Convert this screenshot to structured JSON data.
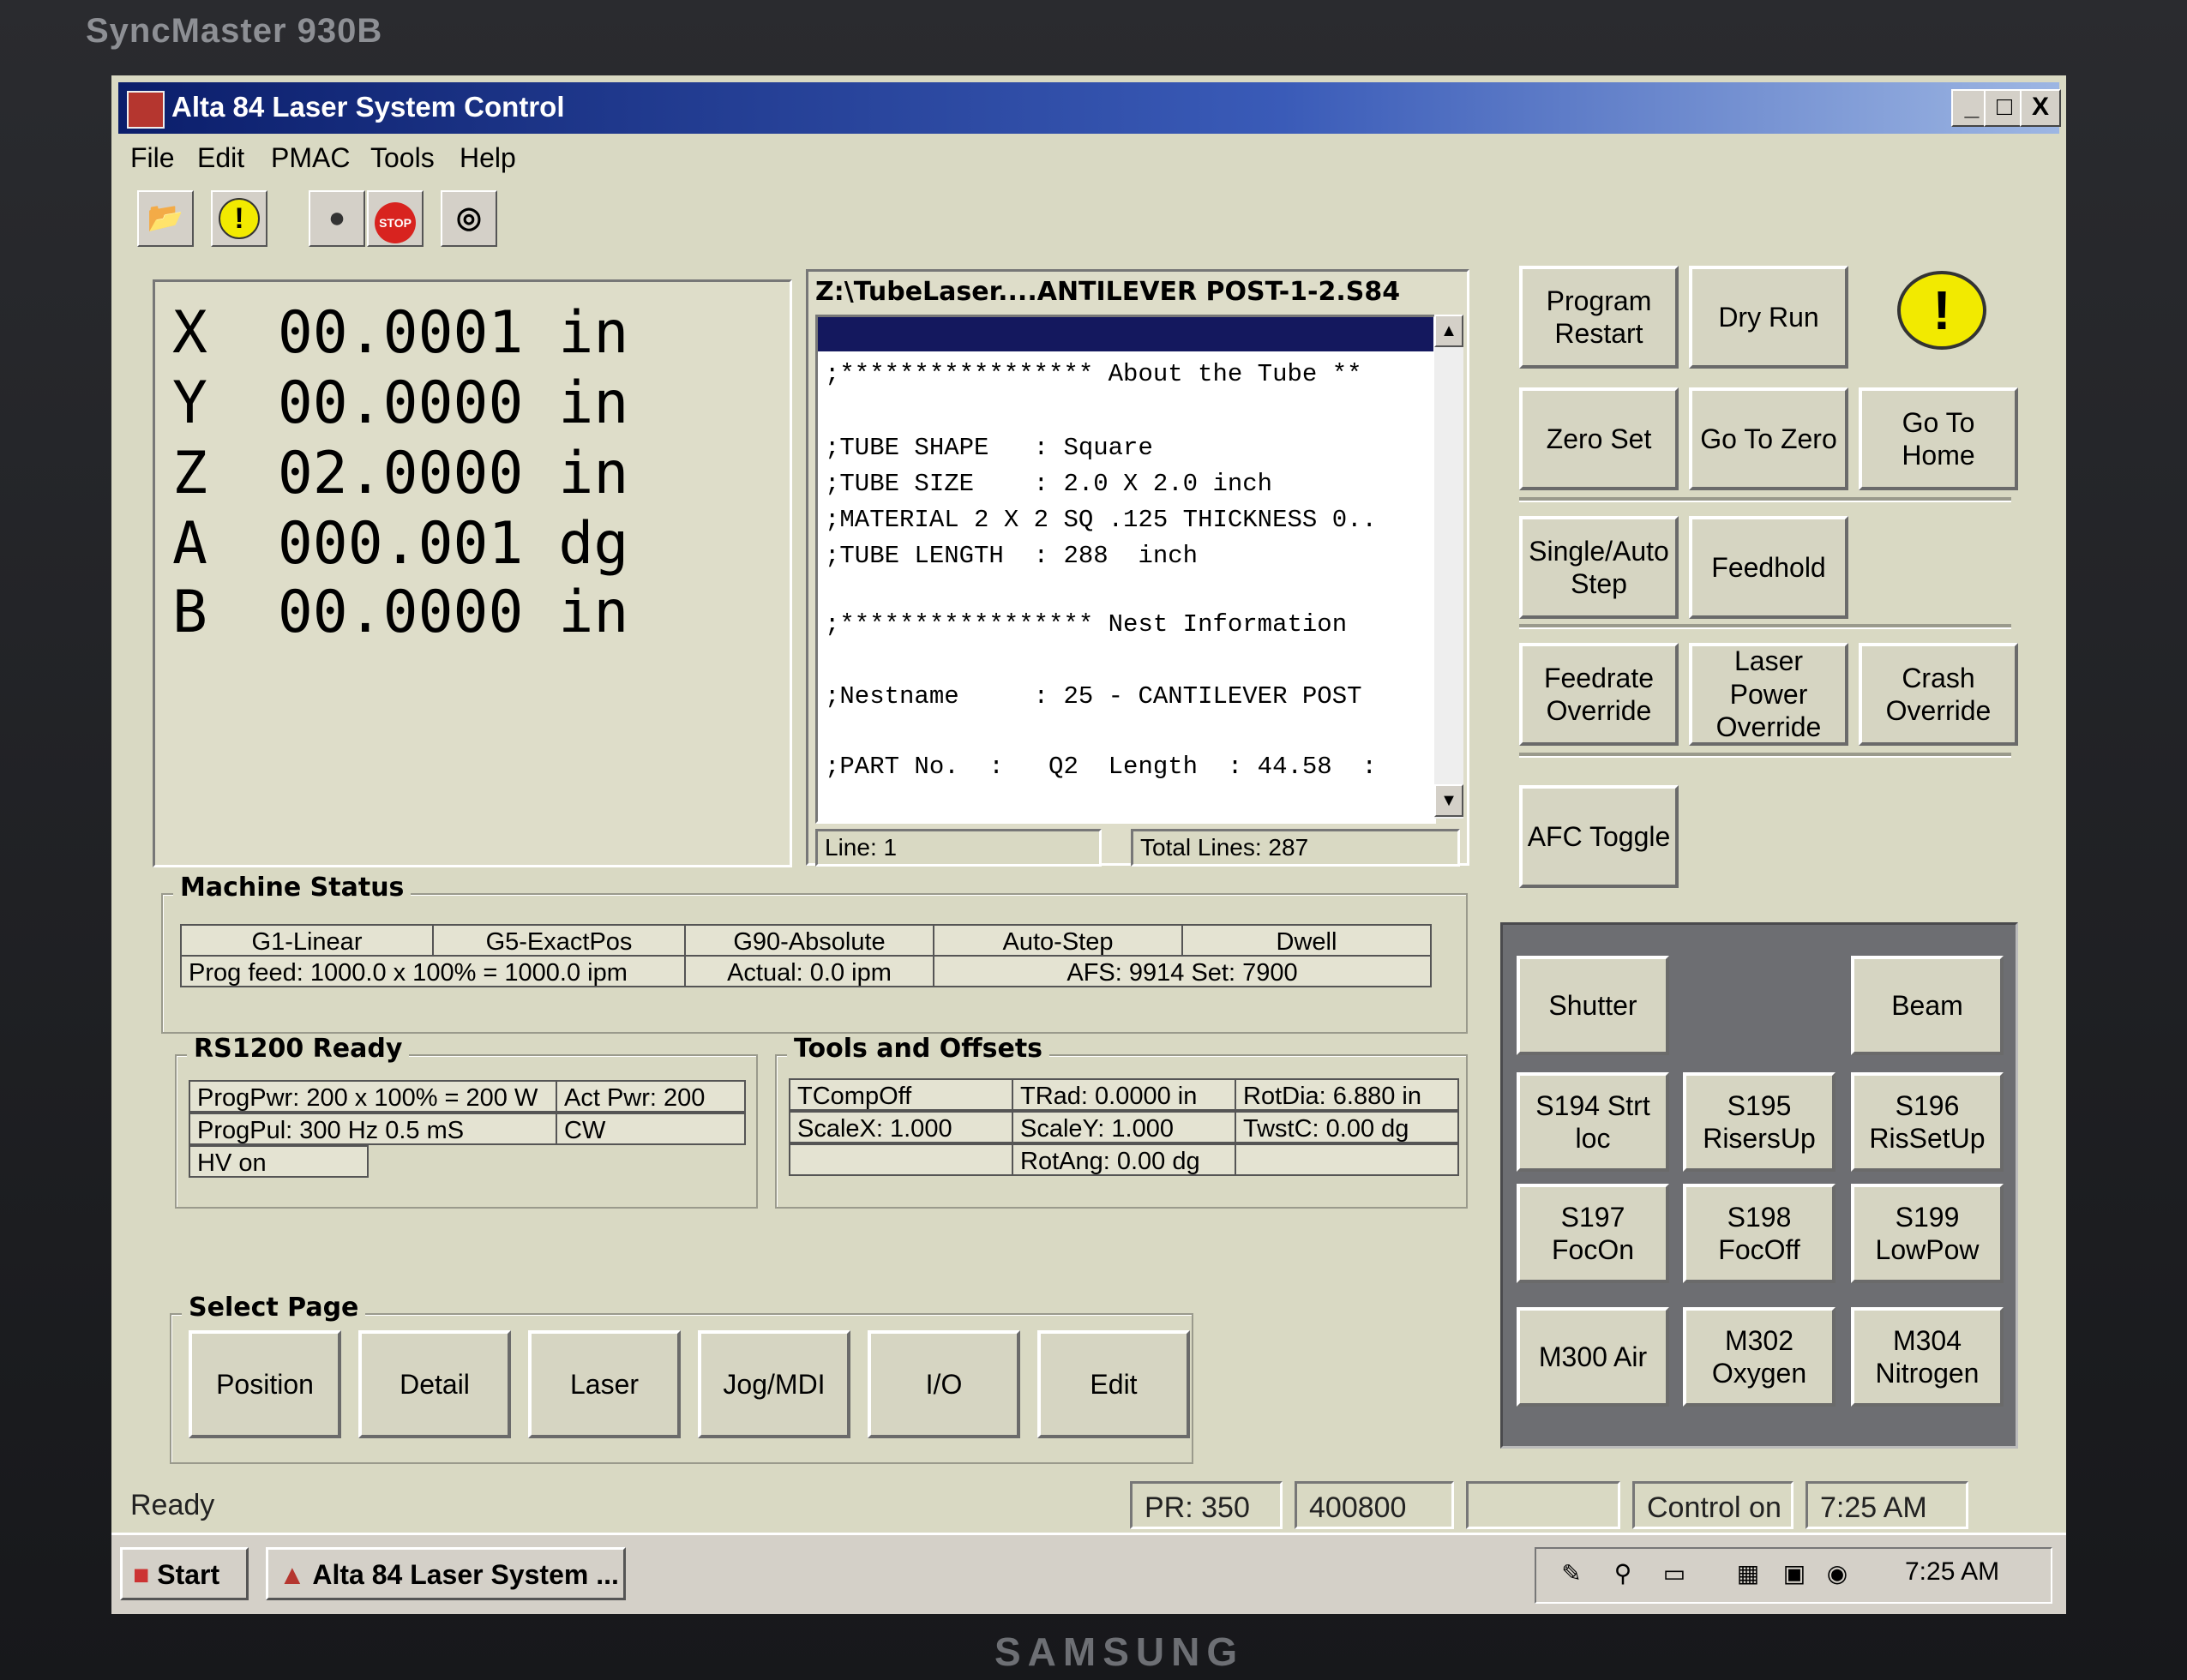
{
  "monitor": {
    "model": "SyncMaster 930B",
    "brand": "SAMSUNG"
  },
  "window": {
    "title": "Alta 84 Laser System Control",
    "min_label": "_",
    "max_label": "□",
    "close_label": "X"
  },
  "menu": [
    "File",
    "Edit",
    "PMAC",
    "Tools",
    "Help"
  ],
  "toolbar": {
    "open_icon": "📂",
    "alert_icon": "!",
    "traffic_icon": "●",
    "stop_label": "STOP",
    "power_icon": "◎"
  },
  "positions": [
    {
      "axis": "X",
      "value": "00.0001",
      "unit": "in"
    },
    {
      "axis": "Y",
      "value": "00.0000",
      "unit": "in"
    },
    {
      "axis": "Z",
      "value": "02.0000",
      "unit": "in"
    },
    {
      "axis": "A",
      "value": "000.001",
      "unit": "dg"
    },
    {
      "axis": "B",
      "value": "00.0000",
      "unit": "in"
    }
  ],
  "file": {
    "title": "Z:\\TubeLaser....ANTILEVER POST-1-2.S84",
    "lines": [
      ";***************** About the Tube **",
      ";TUBE SHAPE   : Square",
      ";TUBE SIZE    : 2.0 X 2.0 inch",
      ";MATERIAL 2 X 2 SQ .125 THICKNESS 0..",
      ";TUBE LENGTH  : 288  inch",
      ";***************** Nest Information",
      ";Nestname     : 25 - CANTILEVER POST",
      ";PART No.  :   Q2  Length  : 44.58  :"
    ],
    "line_label": "Line: 1",
    "total_label": "Total Lines: 287",
    "scroll_up": "▲",
    "scroll_down": "▼"
  },
  "controls": {
    "program_restart": "Program Restart",
    "dry_run": "Dry Run",
    "alert": "!",
    "zero_set": "Zero Set",
    "go_to_zero": "Go To Zero",
    "go_to_home": "Go To Home",
    "single_auto_step": "Single/Auto Step",
    "feedhold": "Feedhold",
    "feedrate_override": "Feedrate Override",
    "laser_power_override": "Laser Power Override",
    "crash_override": "Crash Override",
    "afc_toggle": "AFC Toggle"
  },
  "machine_status": {
    "label": "Machine Status",
    "g1": "G1-Linear",
    "g5": "G5-ExactPos",
    "g90": "G90-Absolute",
    "auto_step": "Auto-Step",
    "dwell": "Dwell",
    "prog_feed": "Prog feed:  1000.0 x 100% =  1000.0 ipm",
    "actual": "Actual:  0.0  ipm",
    "afs": "AFS:  9914  Set:  7900"
  },
  "rs1200": {
    "label": "RS1200  Ready",
    "prog_pwr": "ProgPwr: 200 x 100% = 200 W",
    "act_pwr": "Act Pwr: 200",
    "prog_pul": "ProgPul:  300 Hz  0.5 mS",
    "cw": "CW",
    "hv": "HV on"
  },
  "tools_offsets": {
    "label": "Tools and Offsets",
    "tcomp": "TCompOff",
    "trad": "TRad:  0.0000 in",
    "rotdia": "RotDia:  6.880 in",
    "scalex": "ScaleX: 1.000",
    "scaley": "ScaleY: 1.000",
    "twstc": "TwstC: 0.00 dg",
    "rotang": "RotAng: 0.00 dg"
  },
  "select_page": {
    "label": "Select Page",
    "pages": [
      "Position",
      "Detail",
      "Laser",
      "Jog/MDI",
      "I/O",
      "Edit"
    ]
  },
  "io_panel": {
    "shutter": "Shutter",
    "beam": "Beam",
    "buttons": [
      "S194 Strt loc",
      "S195 RisersUp",
      "S196 RisSetUp",
      "S197 FocOn",
      "S198 FocOff",
      "S199 LowPow",
      "M300 Air",
      "M302 Oxygen",
      "M304 Nitrogen"
    ]
  },
  "status": {
    "ready": "Ready",
    "pr": "PR: 350",
    "code": "400800",
    "control": "Control on",
    "time": "7:25 AM"
  },
  "taskbar": {
    "start": "Start",
    "task": "Alta 84 Laser System ...",
    "time": "7:25 AM"
  }
}
